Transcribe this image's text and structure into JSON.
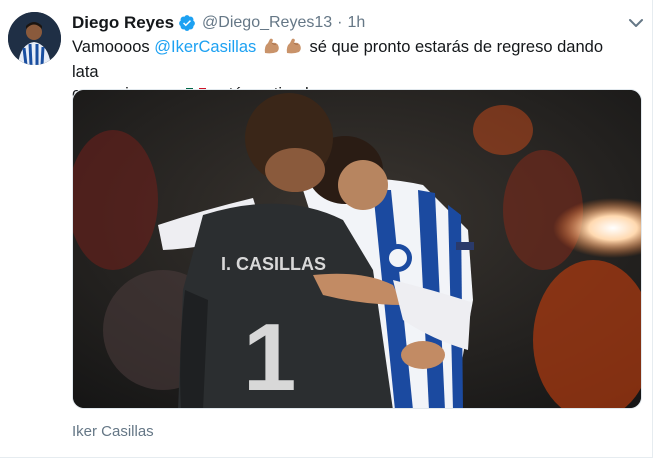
{
  "tweet": {
    "author_name": "Diego Reyes",
    "handle": "@Diego_Reyes13",
    "separator": "·",
    "time": "1h",
    "text_part1": "Vamoooos ",
    "mention": "@IkerCasillas",
    "text_part2": " sé que pronto estarás de regreso dando lata",
    "text_part3": "como siempre. ",
    "text_part4": " está contigo hermanoo ",
    "media_tag": "Iker Casillas",
    "jersey_name": "I. CASILLAS",
    "jersey_number": "1"
  },
  "icons": {
    "verified": "verified-badge-icon",
    "caret": "chevron-down-icon",
    "flexed_biceps": "flexed-biceps-emoji",
    "mexico_flag": "mexico-flag-emoji",
    "fist_bump": "fist-bump-emoji"
  },
  "colors": {
    "link": "#1da1f2",
    "secondary_text": "#657786",
    "primary_text": "#14171a",
    "verified": "#1da1f2"
  }
}
